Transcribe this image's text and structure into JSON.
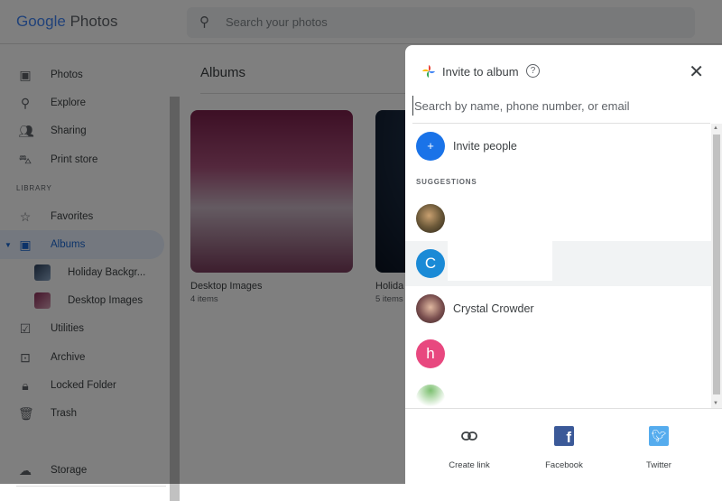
{
  "header": {
    "logo_google": "Google",
    "logo_photos": "Photos",
    "search_placeholder": "Search your photos"
  },
  "sidebar": {
    "items": [
      {
        "label": "Photos"
      },
      {
        "label": "Explore"
      },
      {
        "label": "Sharing"
      },
      {
        "label": "Print store"
      }
    ],
    "library_label": "LIBRARY",
    "library_items": [
      {
        "label": "Favorites"
      },
      {
        "label": "Albums"
      }
    ],
    "albums": [
      {
        "label": "Holiday Backgr..."
      },
      {
        "label": "Desktop Images"
      }
    ],
    "more_items": [
      {
        "label": "Utilities"
      },
      {
        "label": "Archive"
      },
      {
        "label": "Locked Folder"
      },
      {
        "label": "Trash"
      }
    ],
    "storage_label": "Storage"
  },
  "main": {
    "title": "Albums",
    "albums": [
      {
        "name": "Desktop Images",
        "count": "4 items"
      },
      {
        "name": "Holida",
        "count": "5 items"
      }
    ]
  },
  "dialog": {
    "title": "Invite to album",
    "help": "?",
    "close": "✕",
    "search_placeholder": "Search by name, phone number, or email",
    "invite_label": "Invite people",
    "suggestions_label": "SUGGESTIONS",
    "suggestions": [
      {
        "initial": "",
        "name": "",
        "color": "#6d5a3a"
      },
      {
        "initial": "C",
        "name": "",
        "color": "#1a8ad6"
      },
      {
        "initial": "",
        "name": "Crystal Crowder",
        "color": "#7a4f4f"
      },
      {
        "initial": "h",
        "name": "",
        "color": "#e8487f"
      },
      {
        "initial": "",
        "name": "",
        "color": "#5aa84f"
      }
    ],
    "share": [
      {
        "label": "Create link"
      },
      {
        "label": "Facebook"
      },
      {
        "label": "Twitter"
      }
    ]
  }
}
